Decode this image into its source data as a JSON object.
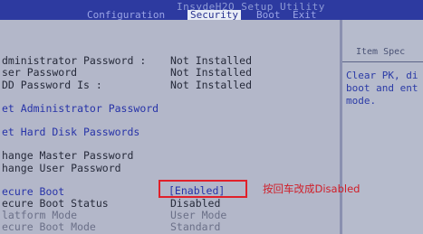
{
  "window": {
    "title": "InsydeH2O Setup Utility"
  },
  "tabs": [
    {
      "label": "Configuration"
    },
    {
      "label": "Security"
    },
    {
      "label": "Boot"
    },
    {
      "label": "Exit"
    }
  ],
  "settings": {
    "admin_pw": {
      "label": "dministrator Password :",
      "value": "Not Installed"
    },
    "user_pw": {
      "label": "ser Password",
      "value": "Not Installed"
    },
    "hdd_pw": {
      "label": "DD Password Is :",
      "value": "Not Installed"
    },
    "set_admin": {
      "label": "et Administrator Password"
    },
    "set_hdd": {
      "label": "et Hard Disk Passwords"
    },
    "change_master": {
      "label": "hange Master Password"
    },
    "change_user": {
      "label": "hange User Password"
    },
    "secure_boot": {
      "label": "ecure Boot",
      "value": "[Enabled]"
    },
    "secure_boot_status": {
      "label": "ecure Boot Status",
      "value": "Disabled"
    },
    "platform_mode": {
      "label": "latform Mode",
      "value": "User Mode"
    },
    "secure_boot_mode": {
      "label": "ecure Boot Mode",
      "value": "Standard"
    }
  },
  "help": {
    "title": "Item Spec",
    "text": "Clear PK, di\nboot and ent\nmode."
  },
  "annotation": {
    "text": "按回车改成Disabled",
    "color": "#d01e28"
  }
}
